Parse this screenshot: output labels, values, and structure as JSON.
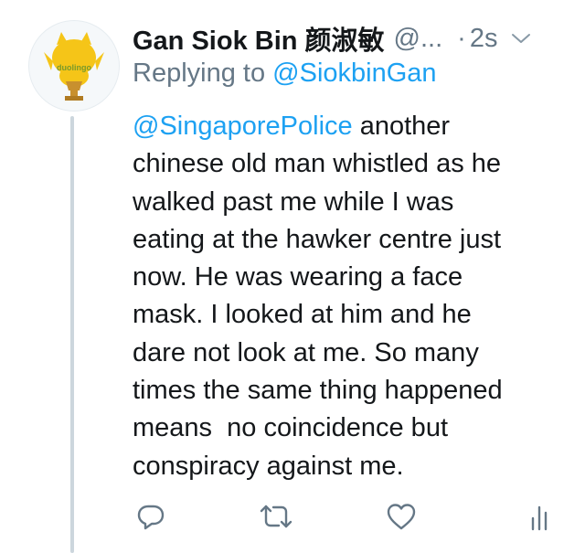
{
  "tweet": {
    "author_name": "Gan Siok Bin 颜淑敏",
    "handle": "@...",
    "separator": "·",
    "time": "2s",
    "replying_prefix": "Replying to",
    "replying_handle": "@SiokbinGan",
    "avatar_logo_text": "duolingo",
    "lines": [
      {
        "mention": "@SingaporePolice",
        "text": " another"
      },
      {
        "text": "chinese old man whistled as he"
      },
      {
        "text": "walked past me while I was"
      },
      {
        "text": "eating at the hawker centre just"
      },
      {
        "text": "now. He was wearing a face"
      },
      {
        "text": "mask. I looked at him and he"
      },
      {
        "text": "dare not look at me. So many"
      },
      {
        "text": "times the same thing happened"
      },
      {
        "text": "means  no coincidence but"
      },
      {
        "text": "conspiracy against me."
      }
    ]
  },
  "actions": [
    {
      "icon": "reply-icon"
    },
    {
      "icon": "retweet-icon"
    },
    {
      "icon": "like-icon"
    },
    {
      "icon": "analytics-icon"
    }
  ],
  "colors": {
    "link": "#1da1f2",
    "secondary_text": "#657786",
    "primary_text": "#14171a",
    "thread_line": "#ccd6dd",
    "owl_yellow": "#f5c518",
    "trophy_brown": "#c8902e"
  }
}
